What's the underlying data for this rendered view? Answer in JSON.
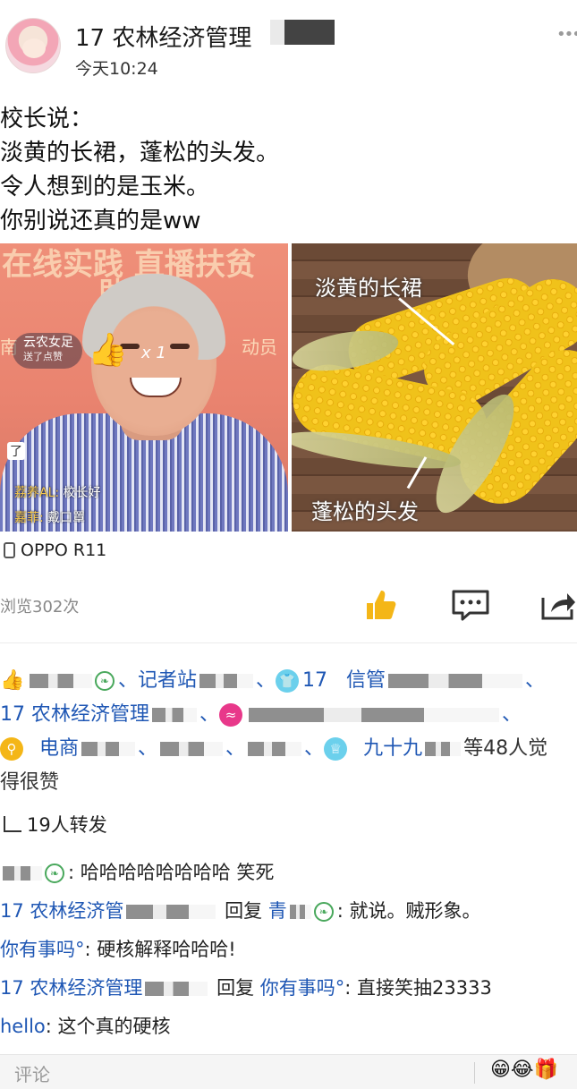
{
  "post": {
    "author": "17 农林经济管理",
    "time": "今天10:24",
    "lines": [
      "校长说：",
      "淡黄的长裙，蓬松的头发。",
      "令人想到的是玉米。",
      "你别说还真的是ww"
    ],
    "device": "OPPO R11",
    "views": "浏览302次"
  },
  "photo_left": {
    "banner_top": "在线实践 直播扶贫",
    "banner_mid": "助",
    "banner_side_left": "南",
    "banner_side_right": "动员",
    "gift_name": "云农女足",
    "gift_sub": "送了点赞",
    "gift_count": "x 1",
    "bubble": "了",
    "chat1_name": "荔养AL:",
    "chat1_text": "校长好",
    "chat2_name": "嘉菲:",
    "chat2_text": "戴口罩"
  },
  "photo_right": {
    "label_skirt": "淡黄的长裙",
    "label_hair": "蓬松的头发"
  },
  "likes": {
    "l1_sep1": "、",
    "l1_name2": "记者站",
    "l1_sep2": "、",
    "l1_name3": "17",
    "l1_name4": "信管",
    "l1_tail": "、",
    "l2_name1": "17 农林经济管理",
    "l2_sep": "、",
    "l3_name1": "电商",
    "l3_sep": "、",
    "l3_name2": "九十九",
    "l3_tail": "等48人觉",
    "l4": "得很赞"
  },
  "forwards": "19人转发",
  "comments": [
    {
      "user": "",
      "text": ": 哈哈哈哈哈哈哈哈 笑死"
    },
    {
      "user": "17 农林经济管",
      "mid": "回复",
      "target": "青",
      "text": ": 就说。贼形象。"
    },
    {
      "user": "你有事吗°",
      "text": ": 硬核解释哈哈哈!"
    },
    {
      "user": "17 农林经济管理",
      "mid": "回复",
      "target": "你有事吗°",
      "text": ": 直接笑抽23333"
    },
    {
      "user": "hello",
      "text": ": 这个真的硬核"
    }
  ],
  "comment_bar": {
    "placeholder": "评论",
    "emoji": "😁😂🎁"
  },
  "colors": {
    "link_blue": "#1f57b4",
    "like_yellow": "#f4b617"
  }
}
